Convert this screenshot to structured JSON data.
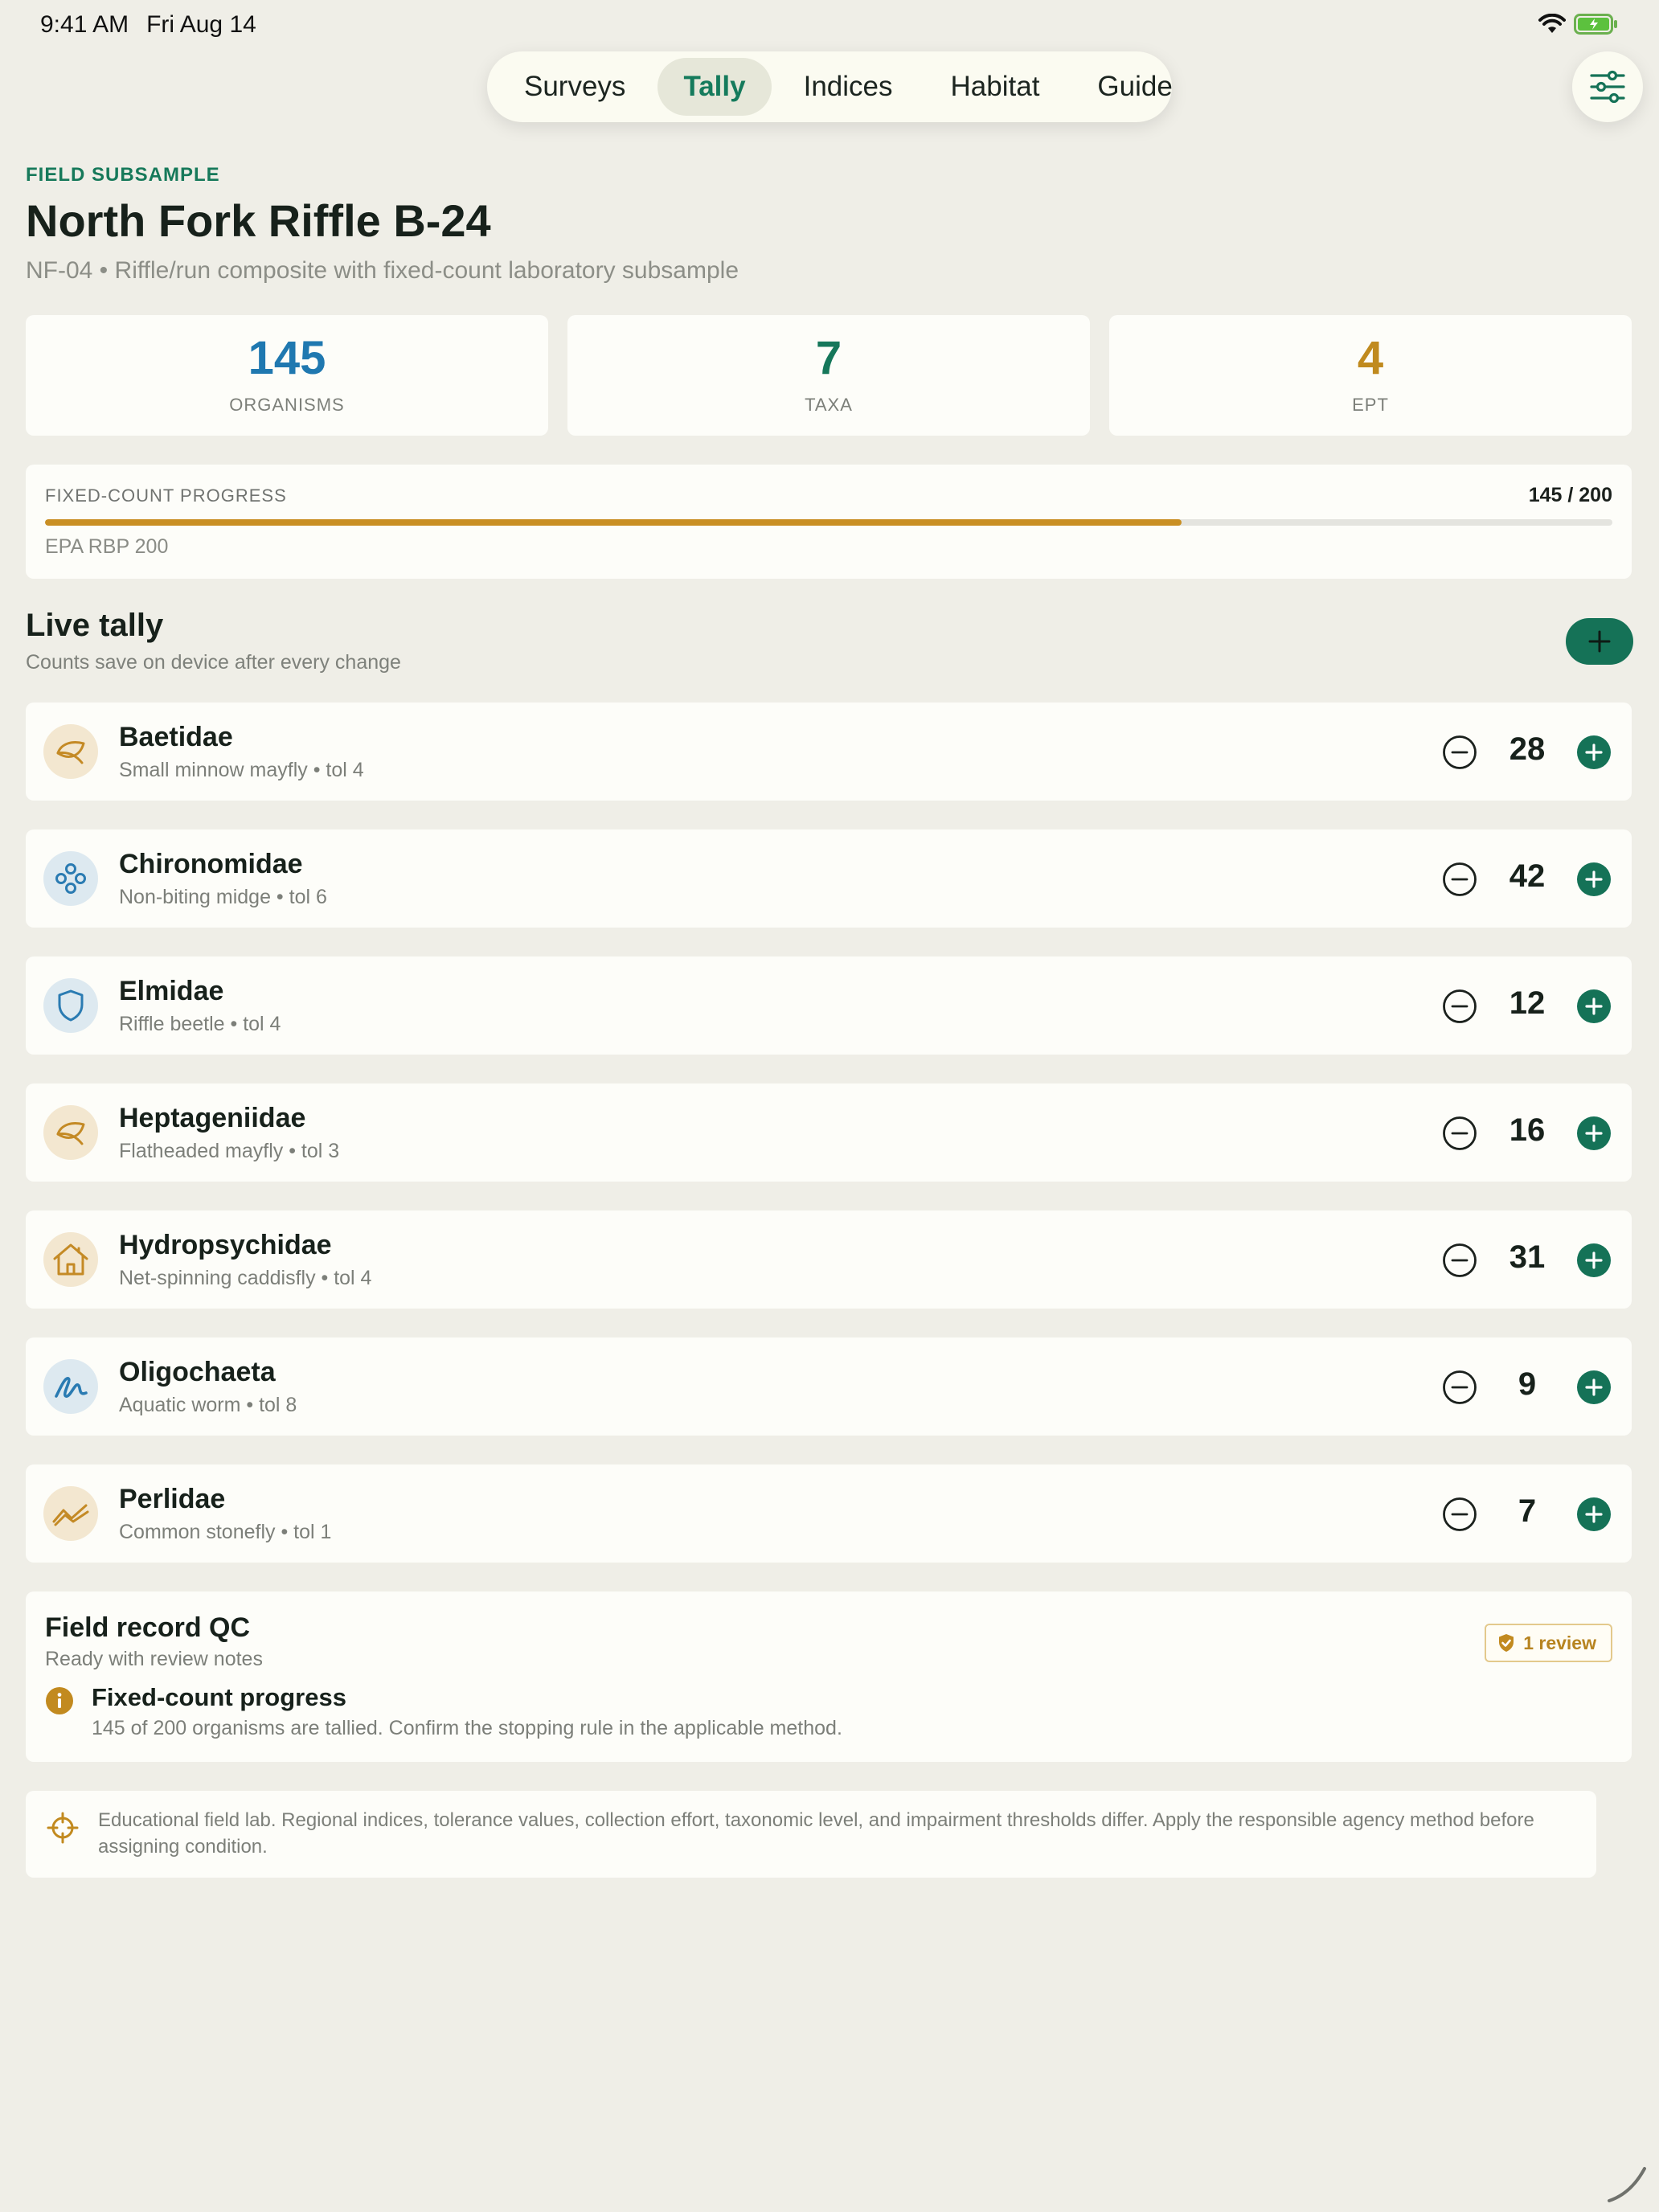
{
  "status_bar": {
    "time": "9:41 AM",
    "date": "Fri Aug 14"
  },
  "nav": {
    "tabs": [
      {
        "label": "Surveys",
        "active": false
      },
      {
        "label": "Tally",
        "active": true
      },
      {
        "label": "Indices",
        "active": false
      },
      {
        "label": "Habitat",
        "active": false
      },
      {
        "label": "Guide",
        "active": false
      }
    ],
    "settings_icon": "sliders-icon"
  },
  "header": {
    "eyebrow": "FIELD SUBSAMPLE",
    "title": "North Fork Riffle B-24",
    "subtitle": "NF-04 • Riffle/run composite with fixed-count laboratory subsample"
  },
  "stats": [
    {
      "value": "145",
      "label": "ORGANISMS",
      "color": "#1f78b0"
    },
    {
      "value": "7",
      "label": "TAXA",
      "color": "#15775a"
    },
    {
      "value": "4",
      "label": "EPT",
      "color": "#c08a1e"
    }
  ],
  "progress": {
    "title": "FIXED-COUNT PROGRESS",
    "count": "145 / 200",
    "fraction": 0.725,
    "method": "EPA RBP 200",
    "color": "#c98f24"
  },
  "tally": {
    "title": "Live tally",
    "subtitle": "Counts save on device after every change",
    "items": [
      {
        "name": "Baetidae",
        "meta": "Small minnow mayfly • tol 4",
        "count": "28",
        "icon": "leaf-icon",
        "icon_color": "#c48a25",
        "icon_bg": "#f3e7d0"
      },
      {
        "name": "Chironomidae",
        "meta": "Non-biting midge • tol 6",
        "count": "42",
        "icon": "molecule-icon",
        "icon_color": "#2a7bb2",
        "icon_bg": "#dde9f0"
      },
      {
        "name": "Elmidae",
        "meta": "Riffle beetle • tol 4",
        "count": "12",
        "icon": "shield-icon",
        "icon_color": "#2a7bb2",
        "icon_bg": "#dde9f0"
      },
      {
        "name": "Heptageniidae",
        "meta": "Flatheaded mayfly • tol 3",
        "count": "16",
        "icon": "leaf-icon",
        "icon_color": "#c48a25",
        "icon_bg": "#f3e7d0"
      },
      {
        "name": "Hydropsychidae",
        "meta": "Net-spinning caddisfly • tol 4",
        "count": "31",
        "icon": "house-icon",
        "icon_color": "#c48a25",
        "icon_bg": "#f3e7d0"
      },
      {
        "name": "Oligochaeta",
        "meta": "Aquatic worm • tol 8",
        "count": "9",
        "icon": "squiggle-icon",
        "icon_color": "#2a7bb2",
        "icon_bg": "#dde9f0"
      },
      {
        "name": "Perlidae",
        "meta": "Common stonefly • tol 1",
        "count": "7",
        "icon": "wave-icon",
        "icon_color": "#c48a25",
        "icon_bg": "#f3e7d0"
      }
    ]
  },
  "qc": {
    "title": "Field record QC",
    "subtitle": "Ready with review notes",
    "badge": "1 review",
    "issue_title": "Fixed-count progress",
    "issue_body": "145 of 200 organisms are tallied. Confirm the stopping rule in the applicable method."
  },
  "disclaimer": {
    "text": "Educational field lab. Regional indices, tolerance values, collection effort, taxonomic level, and impairment thresholds differ. Apply the responsible agency method before assigning condition."
  },
  "colors": {
    "accent": "#157257",
    "warning": "#c98f24",
    "background": "#efeee7"
  }
}
